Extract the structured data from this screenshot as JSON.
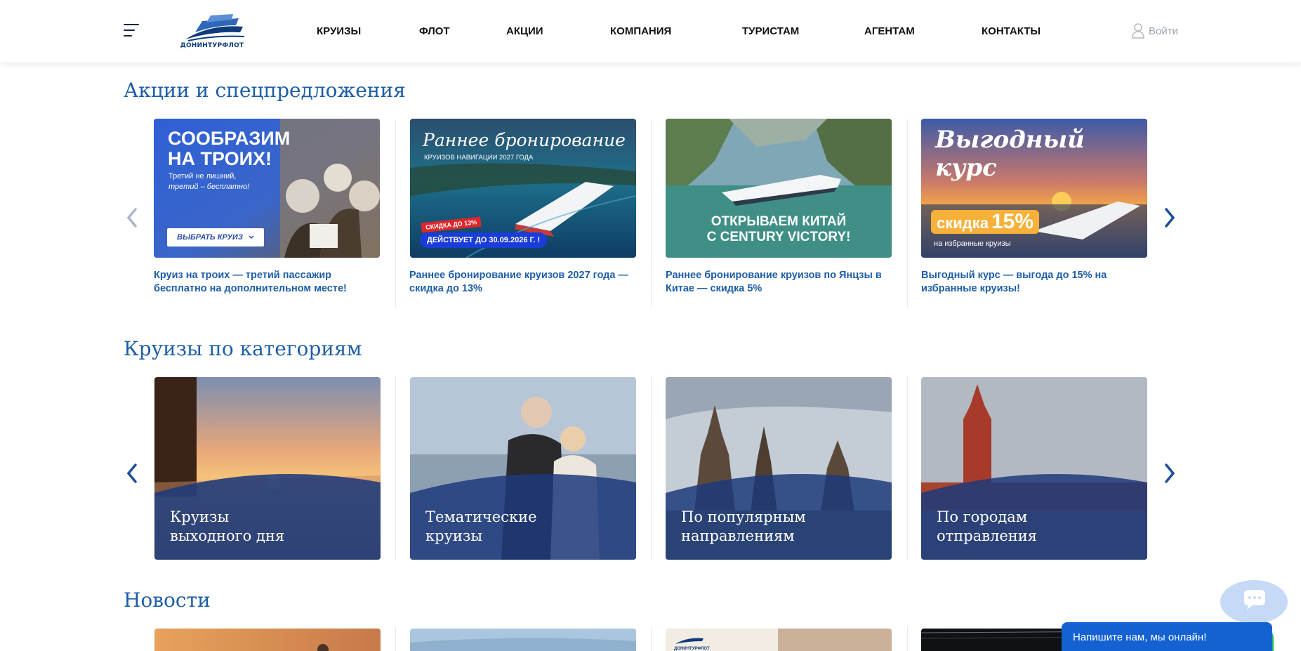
{
  "header": {
    "logo_text": "ДОНИНТУРФЛОТ",
    "nav": [
      "КРУИЗЫ",
      "ФЛОТ",
      "АКЦИИ",
      "КОМПАНИЯ",
      "ТУРИСТАМ",
      "АГЕНТАМ",
      "КОНТАКТЫ"
    ],
    "login_label": "Войти"
  },
  "promotions": {
    "title": "Акции и спецпредложения",
    "cards": [
      {
        "caption": "Круиз на троих — третий пассажир бесплатно на дополнительном месте!",
        "image": {
          "headline_line1": "СООБРАЗИМ",
          "headline_line2": "НА ТРОИХ!",
          "sub_line1": "Третий не лишний,",
          "sub_line2": "третий – бесплатно!",
          "button": "ВЫБРАТЬ КРУИЗ"
        }
      },
      {
        "caption": "Раннее бронирование круизов 2027 года — скидка до 13%",
        "image": {
          "headline": "Раннее бронирование",
          "sub": "КРУИЗОВ НАВИГАЦИИ 2027 ГОДА",
          "badge": "СКИДКА ДО 13%",
          "pill": "ДЕЙСТВУЕТ ДО 30.09.2026 Г. !"
        }
      },
      {
        "caption": "Раннее бронирование круизов по Янцзы в Китае — скидка 5%",
        "image": {
          "line1": "ОТКРЫВАЕМ КИТАЙ",
          "line2": "С CENTURY VICTORY!"
        }
      },
      {
        "caption": "Выгодный курс — выгода до 15% на избранные круизы!",
        "image": {
          "headline_line1": "Выгодный",
          "headline_line2": "курс",
          "discount_label": "скидка",
          "discount_value": "15%",
          "sub": "на избранные круизы"
        }
      }
    ]
  },
  "categories": {
    "title": "Круизы по категориям",
    "cards": [
      {
        "line1": "Круизы",
        "line2": "выходного дня"
      },
      {
        "line1": "Тематические",
        "line2": "круизы"
      },
      {
        "line1": "По популярным",
        "line2": "направлениям"
      },
      {
        "line1": "По городам",
        "line2": "отправления"
      }
    ]
  },
  "news": {
    "title": "Новости",
    "logo_text": "ДОНИНТУРФЛОТ"
  },
  "chat": {
    "bar_text": "Напишите нам, мы онлайн!"
  },
  "colors": {
    "accent_blue": "#1d5ea8",
    "nav_text": "#111111",
    "chat_blue": "#1462d2",
    "chat_green": "#26c24a"
  }
}
